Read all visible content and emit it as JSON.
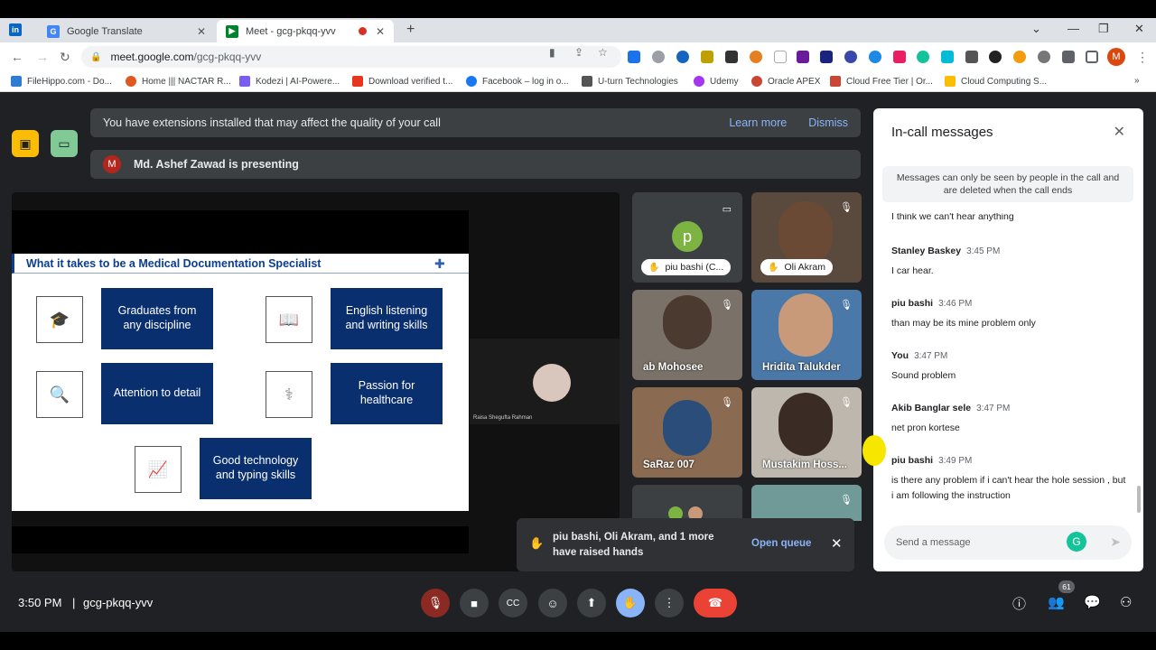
{
  "browser": {
    "tabs": [
      {
        "title": "Google Translate",
        "icon": "translate-icon"
      },
      {
        "title": "Meet - gcg-pkqq-yvv",
        "icon": "meet-icon"
      }
    ],
    "linkedin_glyph": "in",
    "close_glyph": "✕",
    "new_tab_glyph": "+",
    "url_host": "meet.google.com",
    "url_path": "/gcg-pkqq-yvv",
    "profile_initial": "M",
    "bookmarks": [
      {
        "label": "FileHippo.com - Do...",
        "color": "#2e7dd1"
      },
      {
        "label": "Home ||| NACTAR R...",
        "color": "#e0571f"
      },
      {
        "label": "Kodezi | AI-Powere...",
        "color": "#7a5cf0"
      },
      {
        "label": "Download verified t...",
        "color": "#e8351e"
      },
      {
        "label": "Facebook – log in o...",
        "color": "#1877f2"
      },
      {
        "label": "U-turn Technologies",
        "color": "#555555"
      },
      {
        "label": "Udemy",
        "color": "#a435f0"
      },
      {
        "label": "Oracle APEX",
        "color": "#c74634"
      },
      {
        "label": "Cloud Free Tier | Or...",
        "color": "#c74634"
      },
      {
        "label": "Cloud Computing S...",
        "color": "#fbbc04"
      }
    ]
  },
  "meet": {
    "ext_banner": {
      "text": "You have extensions installed that may affect the quality of your call",
      "learn_more": "Learn more",
      "dismiss": "Dismiss"
    },
    "presenting_banner": {
      "initial": "M",
      "text": "Md. Ashef Zawad is presenting"
    },
    "slide": {
      "title": "What it takes to be a Medical Documentation Specialist",
      "boxes": [
        "Graduates from any discipline",
        "English listening and writing skills",
        "Attention to detail",
        "Passion for healthcare",
        "Good technology and typing skills"
      ]
    },
    "pip_name": "Raisa Shegufta Rahman",
    "tiles": [
      {
        "name": "piu bashi (C...",
        "initial": "p",
        "pill": true
      },
      {
        "name": "Oli Akram",
        "pill": true
      },
      {
        "name": "ab Mohosee"
      },
      {
        "name": "Hridita Talukder"
      },
      {
        "name": "SaRaz 007"
      },
      {
        "name": "Mustakim Hoss..."
      }
    ],
    "raised_hands": {
      "text": "piu bashi, Oli Akram, and 1 more have raised hands",
      "open_queue": "Open queue"
    },
    "clock": "3:50 PM",
    "meeting_id": "gcg-pkqq-yvv",
    "people_count": "61"
  },
  "chat": {
    "title": "In-call messages",
    "info": "Messages can only be seen by people in the call and are deleted when the call ends",
    "partial_top": "I think we can't hear anything",
    "messages": [
      {
        "sender": "Stanley Baskey",
        "time": "3:45 PM",
        "text": "I car hear."
      },
      {
        "sender": "piu bashi",
        "time": "3:46 PM",
        "text": "than may be its mine problem only"
      },
      {
        "sender": "You",
        "time": "3:47 PM",
        "text": "Sound problem"
      },
      {
        "sender": "Akib Banglar sele",
        "time": "3:47 PM",
        "text": "net pron kortese"
      },
      {
        "sender": "piu bashi",
        "time": "3:49 PM",
        "text": "is there any problem if i can't hear the hole session , but i am following the instruction"
      }
    ],
    "input_placeholder": "Send a message"
  },
  "colors": {
    "accent": "#8ab4f8",
    "leave": "#ea4335",
    "hand_active": "#8ab4f8",
    "mic_off": "#ea4335"
  }
}
